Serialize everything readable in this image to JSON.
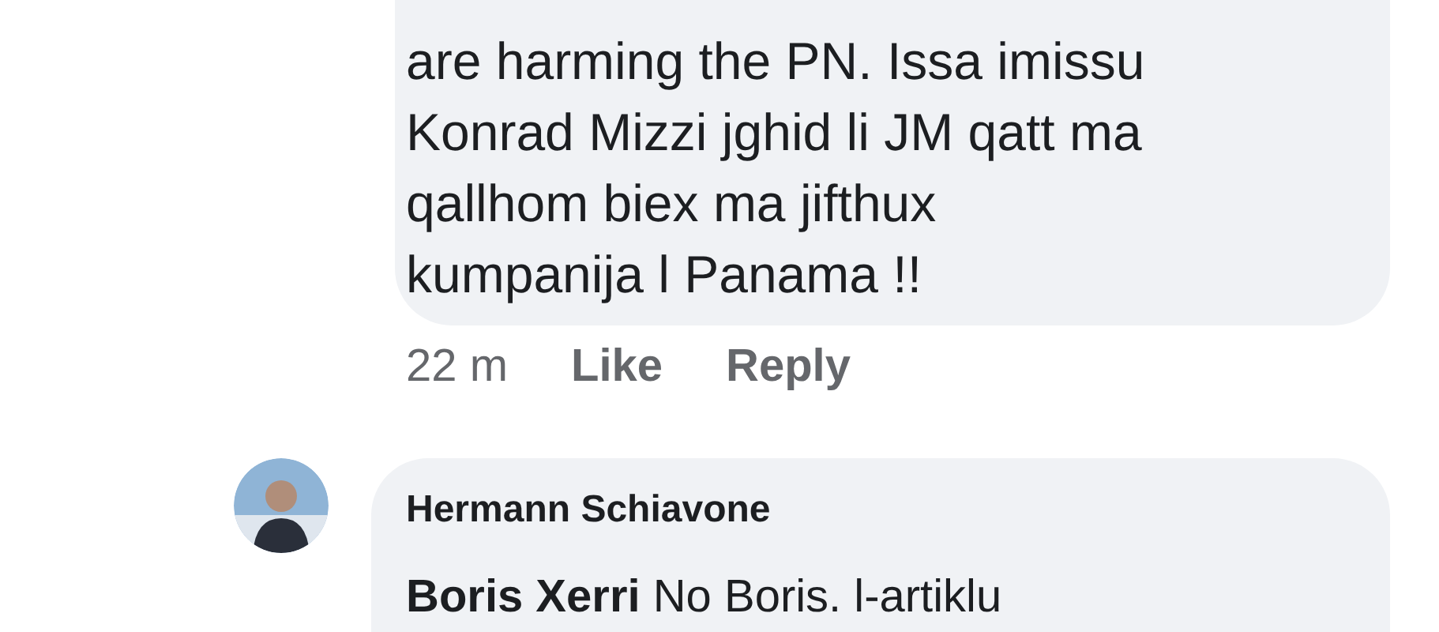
{
  "comments": [
    {
      "text": "are harming the PN. Issa imissu\nKonrad Mizzi jghid li JM qatt ma\nqallhom biex ma jifthux\nkumpanija l Panama !!",
      "time": "22 m",
      "actions": [
        "Like",
        "Reply"
      ]
    },
    {
      "author": "Hermann Schiavone",
      "text": "**Boris Xerri** No Boris. l-artiklu"
    }
  ]
}
